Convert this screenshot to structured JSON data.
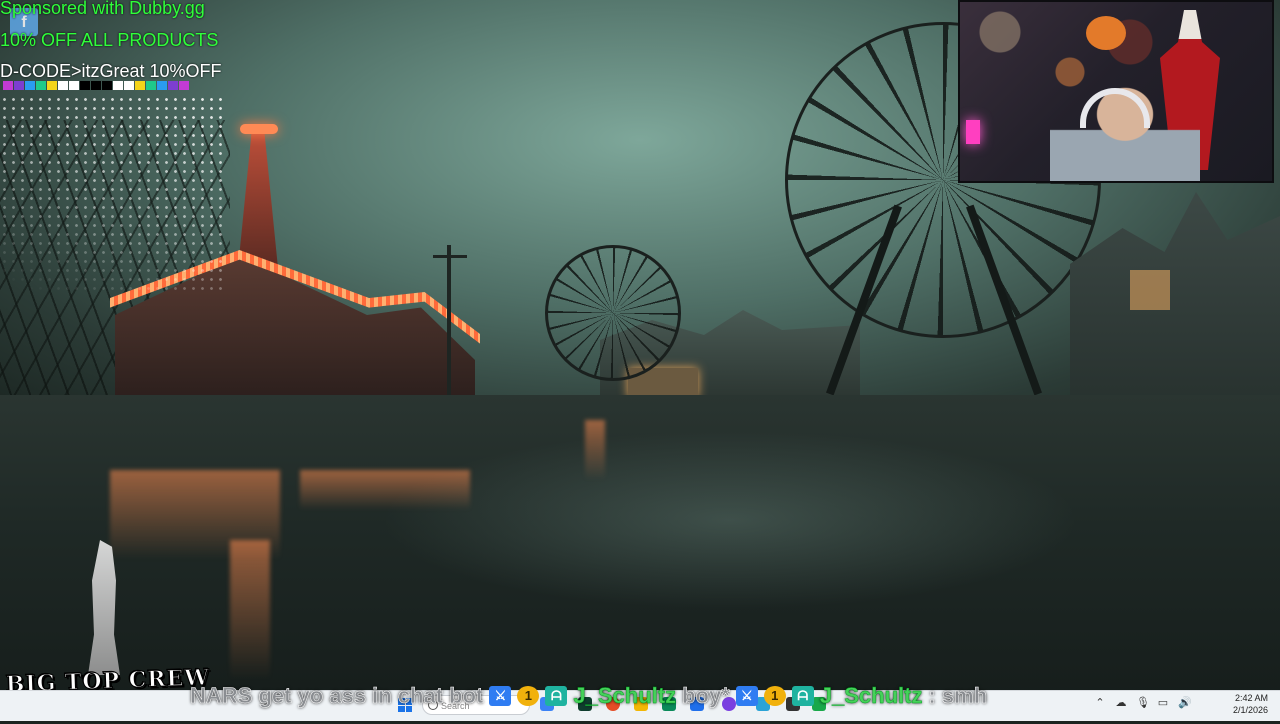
{
  "sponsor": {
    "line1": "Sponsored with Dubby.gg",
    "line2": "10% OFF ALL PRODUCTS",
    "code": "D-CODE>itzGreat 10%OFF",
    "icon": "facebook-icon",
    "swatch_colors": [
      "#c23bd4",
      "#7d3ed0",
      "#2a9cf0",
      "#1fc98a",
      "#f4d41a",
      "#ffffff",
      "#ffffff",
      "#000000",
      "#000000",
      "#000000",
      "#ffffff",
      "#ffffff",
      "#f4d41a",
      "#1fc98a",
      "#2a9cf0",
      "#7d3ed0",
      "#c23bd4"
    ]
  },
  "webcam": {
    "description_icon": "webcam-feed"
  },
  "logo": {
    "text": "BIG TOP CREW"
  },
  "ticker": {
    "lead": "NARS get yo ass in chat bot",
    "messages": [
      {
        "user": "J_Schultz",
        "text": "boy*"
      },
      {
        "user": "J_Schultz",
        "text": ": smh"
      }
    ],
    "badge_gold": "1"
  },
  "taskbar": {
    "search_placeholder": "Search"
  },
  "clock": {
    "time": "2:42 AM",
    "date": "2/1/2026"
  },
  "colors": {
    "sponsor_green": "#2fff3a",
    "username_green": "#46d05a",
    "taskbar_bg": "#eef2f5"
  }
}
